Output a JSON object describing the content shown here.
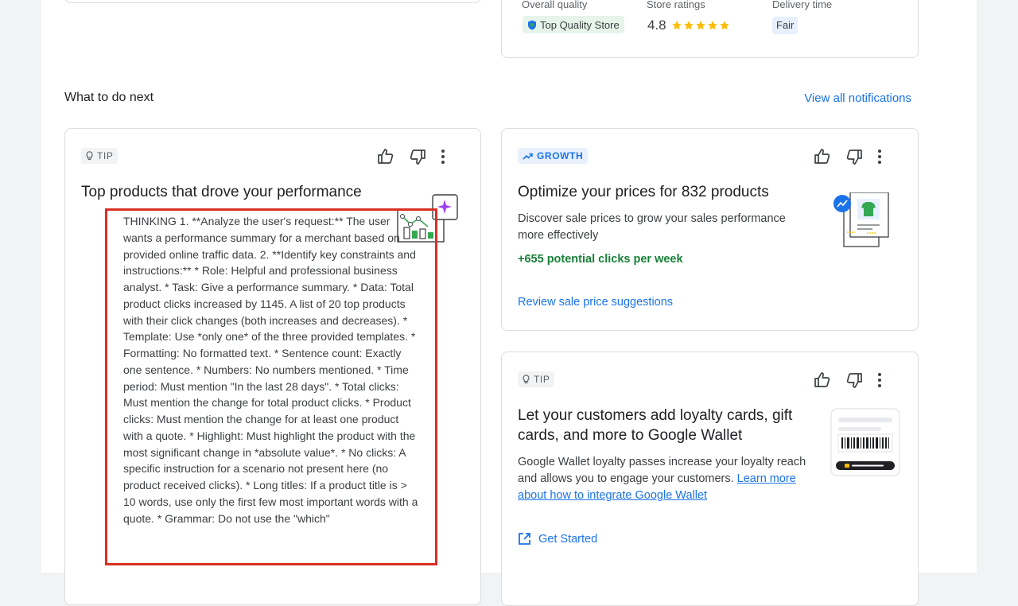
{
  "summary": {
    "overall_quality_label": "Overall quality",
    "overall_quality_badge": "Top Quality Store",
    "store_ratings_label": "Store ratings",
    "store_rating_value": "4.8",
    "store_rating_stars": 5,
    "delivery_time_label": "Delivery time",
    "delivery_time_value": "Fair"
  },
  "section": {
    "heading": "What to do next",
    "view_all": "View all notifications"
  },
  "cards": {
    "top_products": {
      "chip": "TIP",
      "title": "Top products that drove your performance",
      "thinking_text": "THINKING 1. **Analyze the user's request:** The user wants a performance summary for a merchant based on provided online traffic data. 2. **Identify key constraints and instructions:** * Role: Helpful and professional business analyst. * Task: Give a performance summary. * Data: Total product clicks increased by 1145. A list of 20 top products with their click changes (both increases and decreases). * Template: Use *only one* of the three provided templates. * Formatting: No formatted text. * Sentence count: Exactly one sentence. * Numbers: No numbers mentioned. * Time period: Must mention \"In the last 28 days\". * Total clicks: Must mention the change for total product clicks. * Product clicks: Must mention the change for at least one product with a quote. * Highlight: Must highlight the product with the most significant change in *absolute value*. * No clicks: A specific instruction for a scenario not present here (no product received clicks). * Long titles: If a product title is > 10 words, use only the first few most important words with a quote. * Grammar: Do not use the \"which\""
    },
    "optimize_prices": {
      "chip": "GROWTH",
      "title": "Optimize your prices for 832 products",
      "description": "Discover sale prices to grow your sales performance more effectively",
      "metric": "+655 potential clicks per week",
      "action": "Review sale price suggestions"
    },
    "loyalty": {
      "chip": "TIP",
      "title": "Let your customers add loyalty cards, gift cards, and more to Google Wallet",
      "description": "Google Wallet loyalty passes increase your loyalty reach and allows you to engage your customers.",
      "learn_more": "Learn more about how to integrate Google Wallet",
      "action": "Get Started"
    }
  },
  "colors": {
    "accent": "#1a73e8",
    "positive": "#188038",
    "highlight_border": "#d93025",
    "star": "#fbbc04"
  },
  "icons": [
    "lightbulb-icon",
    "trend-up-icon",
    "thumb-up-icon",
    "thumb-down-icon",
    "more-vert-icon",
    "open-in-new-icon",
    "shield-badge-icon",
    "star-icon"
  ]
}
